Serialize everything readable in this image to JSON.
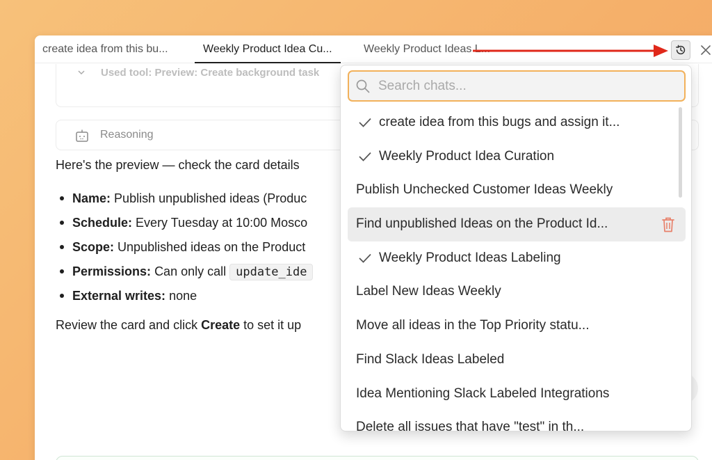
{
  "tabs": [
    {
      "label": "create idea from this bu..."
    },
    {
      "label": "Weekly Product Idea Cu..."
    },
    {
      "label": "Weekly Product Ideas L..."
    }
  ],
  "tool_card": {
    "faded_text": "Used tool: Preview: Create background task"
  },
  "reasoning": {
    "label": "Reasoning"
  },
  "chat": {
    "intro": "Here's the preview — check the card details",
    "bullets": [
      {
        "key": "Name:",
        "value": "Publish unpublished ideas (Produc"
      },
      {
        "key": "Schedule:",
        "value": "Every Tuesday at 10:00 Mosco"
      },
      {
        "key": "Scope:",
        "value": "Unpublished ideas on the Product"
      },
      {
        "key": "Permissions:",
        "value": "Can only call ",
        "code": "update_ide"
      },
      {
        "key": "External writes:",
        "value": "none"
      }
    ],
    "closing_pre": "Review the card and click ",
    "closing_bold": "Create",
    "closing_post": " to set it up"
  },
  "search": {
    "placeholder": "Search chats...",
    "value": ""
  },
  "history_items": [
    {
      "label": "create idea from this bugs and assign it...",
      "checked": true
    },
    {
      "label": "Weekly Product Idea Curation",
      "checked": true
    },
    {
      "label": "Publish Unchecked Customer Ideas Weekly",
      "checked": false
    },
    {
      "label": "Find unpublished Ideas on the Product Id...",
      "checked": false,
      "hover": true
    },
    {
      "label": "Weekly Product Ideas Labeling",
      "checked": true
    },
    {
      "label": "Label New Ideas Weekly",
      "checked": false
    },
    {
      "label": "Move all ideas in the Top Priority statu...",
      "checked": false
    },
    {
      "label": "Find Slack Ideas Labeled",
      "checked": false
    },
    {
      "label": "Idea Mentioning Slack Labeled Integrations",
      "checked": false
    },
    {
      "label": "Delete all issues that have \"test\" in th...",
      "checked": false
    }
  ],
  "icons": {
    "history": "history-icon",
    "close": "close-icon",
    "search": "search-icon",
    "check": "check-icon",
    "trash": "trash-icon",
    "robot": "robot-icon"
  },
  "colors": {
    "accent_orange": "#f2b15a",
    "annotation_arrow": "#e0281a",
    "trash": "#e8806a",
    "background_gradient": [
      "#f7c17a",
      "#f3a463"
    ]
  }
}
